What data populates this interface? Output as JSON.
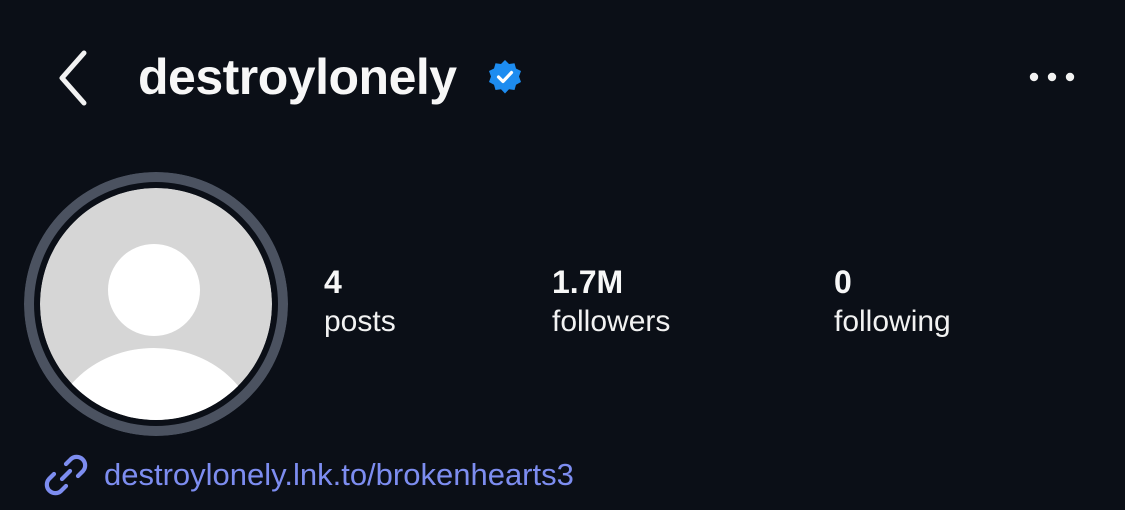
{
  "header": {
    "username": "destroylonely",
    "back_icon": "chevron-left-icon",
    "verified_icon": "verified-badge-icon",
    "more_icon": "more-horizontal-icon"
  },
  "profile": {
    "avatar_icon": "default-avatar-icon"
  },
  "stats": {
    "posts": {
      "value": "4",
      "label": "posts"
    },
    "followers": {
      "value": "1.7M",
      "label": "followers"
    },
    "following": {
      "value": "0",
      "label": "following"
    }
  },
  "link": {
    "icon": "link-icon",
    "text": "destroylonely.lnk.to/brokenhearts3"
  },
  "colors": {
    "background": "#0b0f17",
    "text": "#f7f7f7",
    "verified_blue": "#1d8cf0",
    "link": "#7d8df0",
    "avatar_ring": "#4b5260",
    "avatar_fill": "#d6d6d6"
  }
}
